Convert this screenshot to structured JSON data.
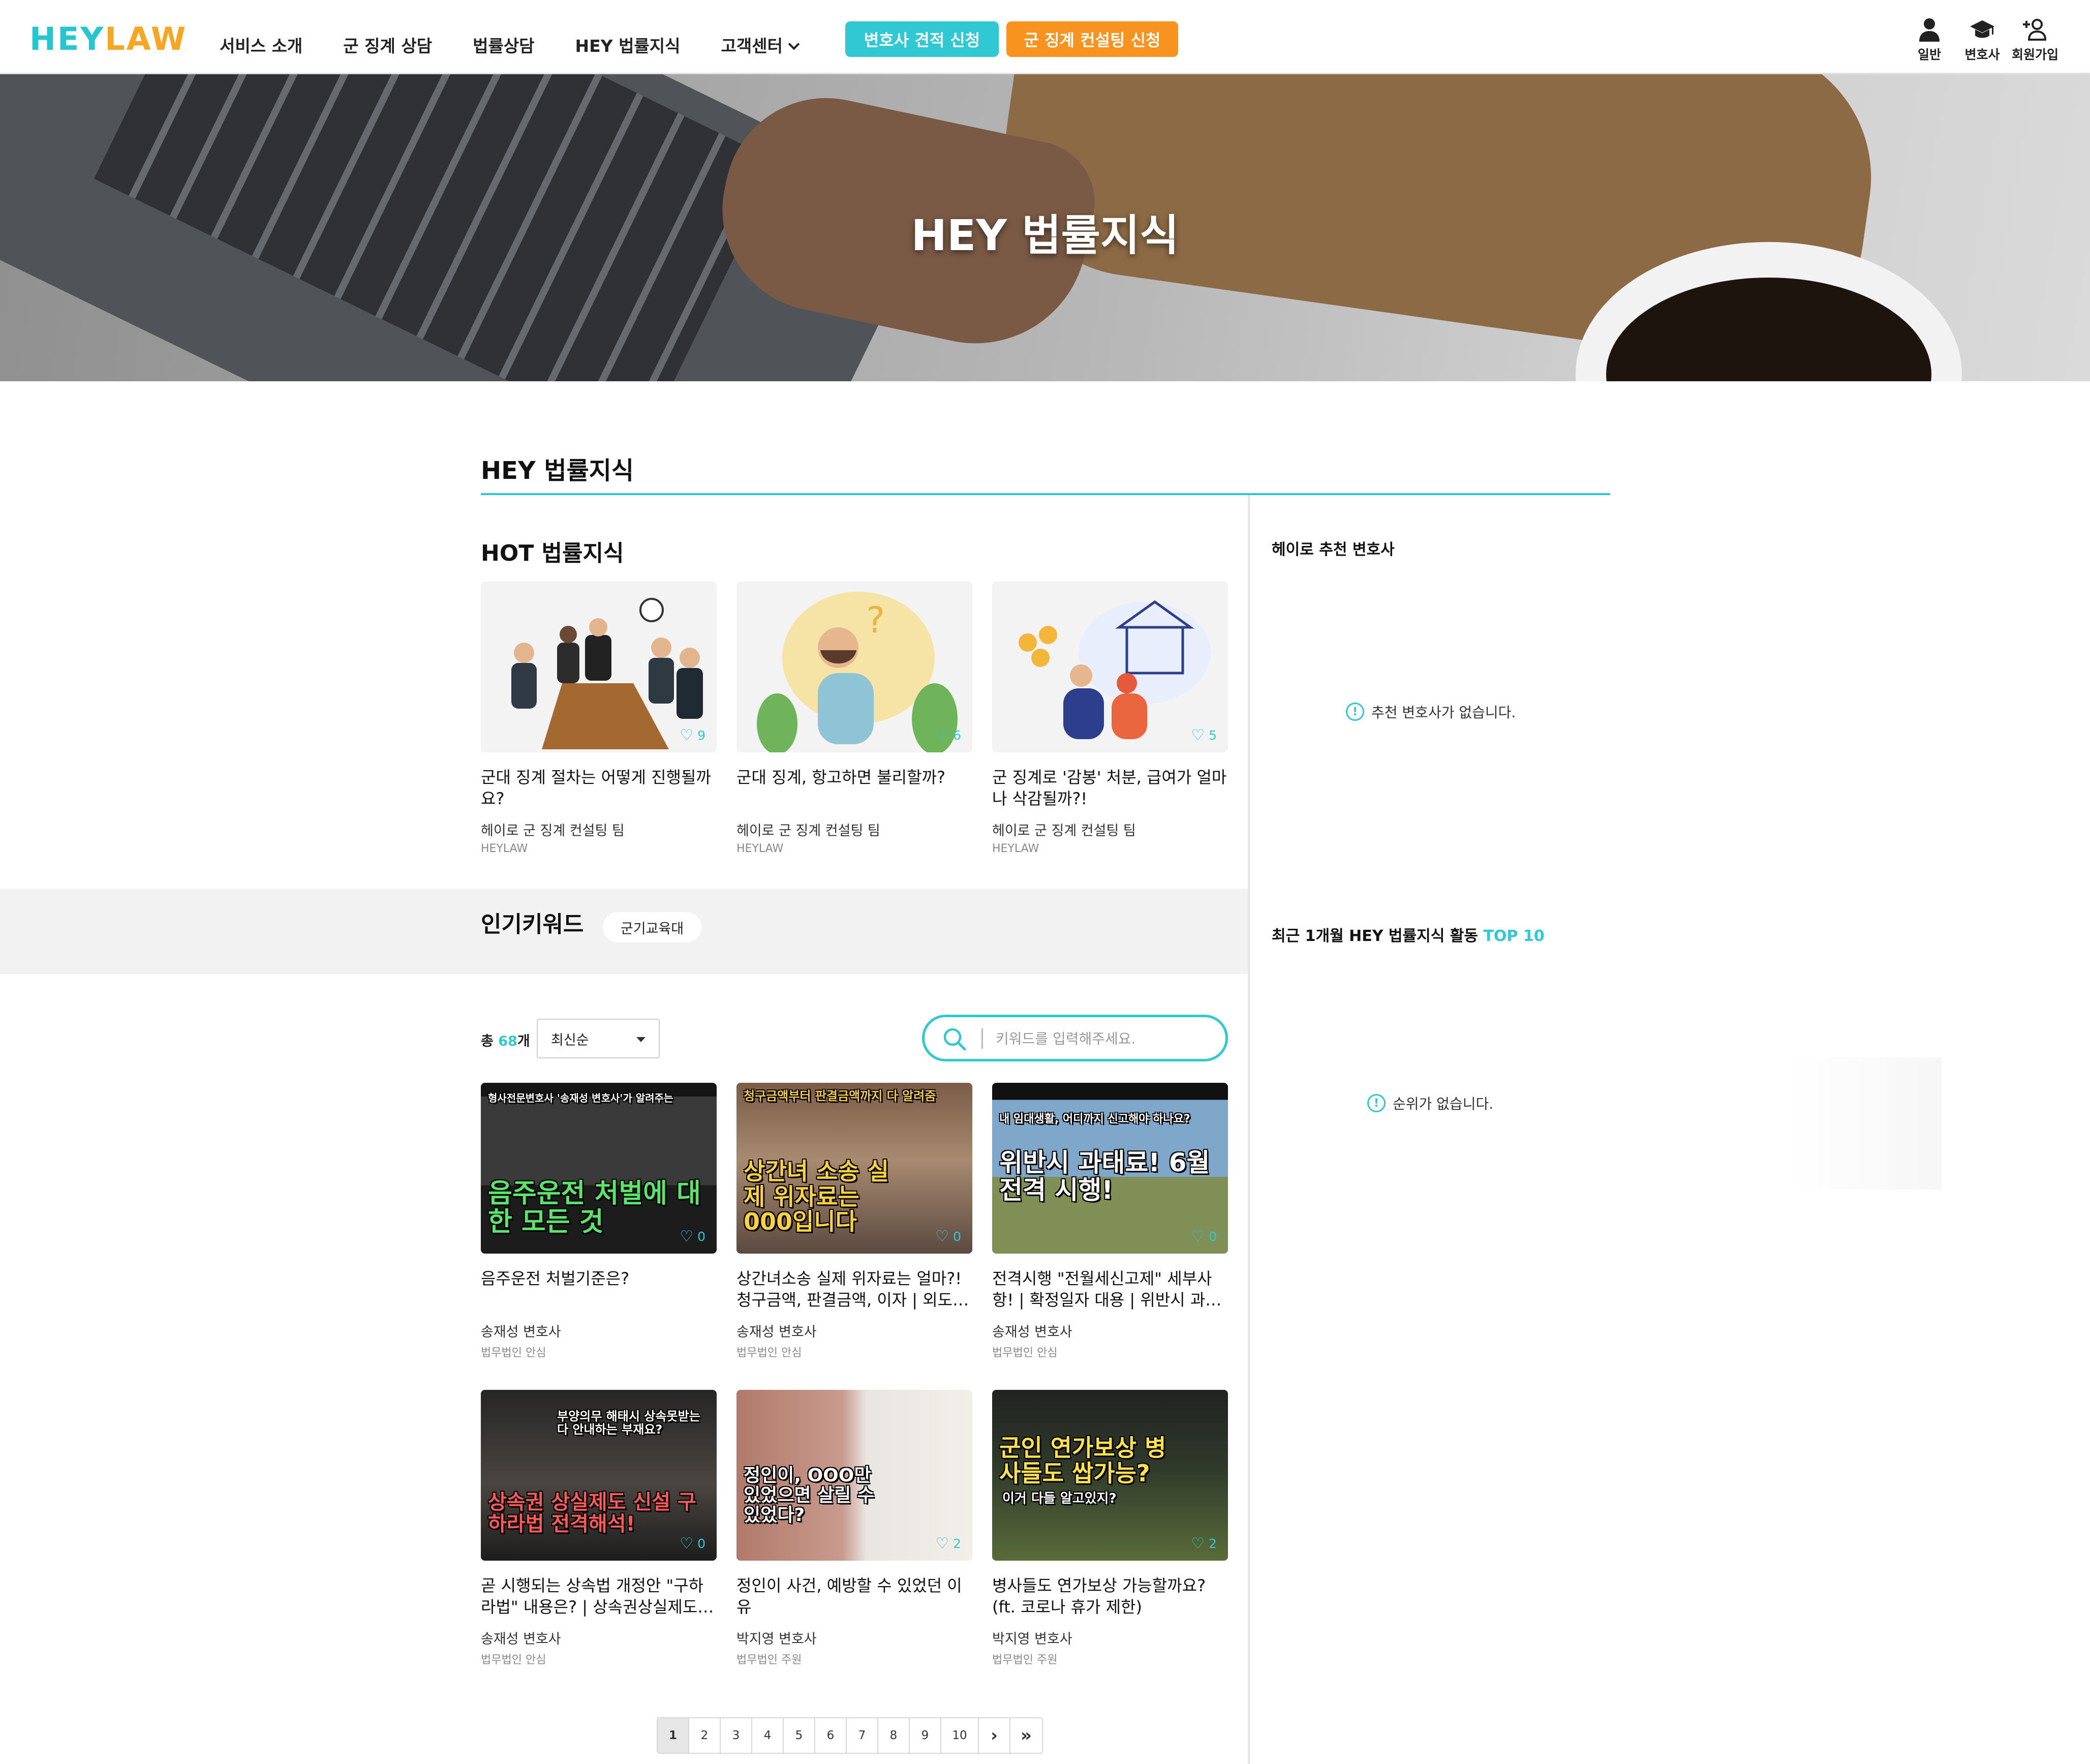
{
  "brand": {
    "logo_hey": "HEY",
    "logo_law": "LAW"
  },
  "nav": {
    "items": [
      "서비스 소개",
      "군 징계 상담",
      "법률상담",
      "HEY 법률지식",
      "고객센터"
    ],
    "btn_quote": "변호사 견적 신청",
    "btn_consult": "군 징계 컨설팅 신청"
  },
  "user_menu": {
    "general": "일반",
    "lawyer": "변호사",
    "signup": "회원가입"
  },
  "hero": {
    "title": "HEY 법률지식"
  },
  "page": {
    "heading": "HEY 법률지식"
  },
  "hot": {
    "title": "HOT 법률지식",
    "cards": [
      {
        "title": "군대 징계 절차는 어떻게 진행될까요?",
        "author": "헤이로 군 징계 컨설팅 팀",
        "org": "HEYLAW",
        "likes": "9"
      },
      {
        "title": "군대 징계, 항고하면 불리할까?",
        "author": "헤이로 군 징계 컨설팅 팀",
        "org": "HEYLAW",
        "likes": "6"
      },
      {
        "title": "군 징계로 '감봉' 처분, 급여가 얼마나 삭감될까?!",
        "author": "헤이로 군 징계 컨설팅 팀",
        "org": "HEYLAW",
        "likes": "5"
      }
    ]
  },
  "keywords": {
    "title": "인기키워드",
    "chip": "군기교육대"
  },
  "list": {
    "total_prefix": "총 ",
    "total_count": "68",
    "total_suffix": "개",
    "sort_selected": "최신순",
    "search_placeholder": "키워드를 입력해주세요.",
    "cards": [
      {
        "title": "음주운전 처벌기준은?",
        "author": "송재성 변호사",
        "org": "법무법인 안심",
        "likes": "0",
        "cap_small": "형사전문변호사 '송재성 변호사'가 알려주는",
        "cap_big": "음주운전 처벌에 대한 모든 것"
      },
      {
        "title": "상간녀소송 실제 위자료는 얼마?! 청구금액, 판결금액, 이자 | 외도…",
        "author": "송재성 변호사",
        "org": "법무법인 안심",
        "likes": "0",
        "cap_small": "청구금액부터 판결금액까지 다 알려줌",
        "cap_big": "상간녀 소송 실제 위자료는 000입니다"
      },
      {
        "title": "전격시행 \"전월세신고제\" 세부사항! | 확정일자 대용 | 위반시 과…",
        "author": "송재성 변호사",
        "org": "법무법인 안심",
        "likes": "0",
        "cap_small": "내 임대생활, 어디까지 신고해야 하나요?",
        "cap_big": "위반시 과태료! 6월전격 시행!"
      },
      {
        "title": "곧 시행되는 상속법 개정안 \"구하라법\" 내용은? | 상속권상실제도…",
        "author": "송재성 변호사",
        "org": "법무법인 안심",
        "likes": "0",
        "cap_small": "부양의무 해태시 상속못받는다 안내하는 부재요?",
        "cap_big": "상속권 상실제도 신설 구하라법 전격해석!"
      },
      {
        "title": "정인이 사건, 예방할 수 있었던 이유",
        "author": "박지영 변호사",
        "org": "법무법인 주원",
        "likes": "2",
        "cap_small": "",
        "cap_big": "정인이, OOO만 있었으면 살릴 수 있었다?"
      },
      {
        "title": "병사들도 연가보상 가능할까요?(ft. 코로나 휴가 제한)",
        "author": "박지영 변호사",
        "org": "법무법인 주원",
        "likes": "2",
        "cap_small": "이거 다들 알고있지?",
        "cap_big": "군인 연가보상 병사들도 쌉가능?"
      }
    ]
  },
  "pagination": {
    "pages": [
      "1",
      "2",
      "3",
      "4",
      "5",
      "6",
      "7",
      "8",
      "9",
      "10"
    ],
    "next": "›",
    "last": "»"
  },
  "sidebar": {
    "recommend_title": "헤이로 추천 변호사",
    "recommend_empty": "추천 변호사가 없습니다.",
    "top_title": "최근 1개월 HEY 법률지식 활동 ",
    "top_badge": "TOP 10",
    "top_empty": "순위가 없습니다."
  },
  "colors": {
    "accent": "#30c8d2",
    "orange": "#f7931e",
    "logo_law": "#f5a623"
  }
}
